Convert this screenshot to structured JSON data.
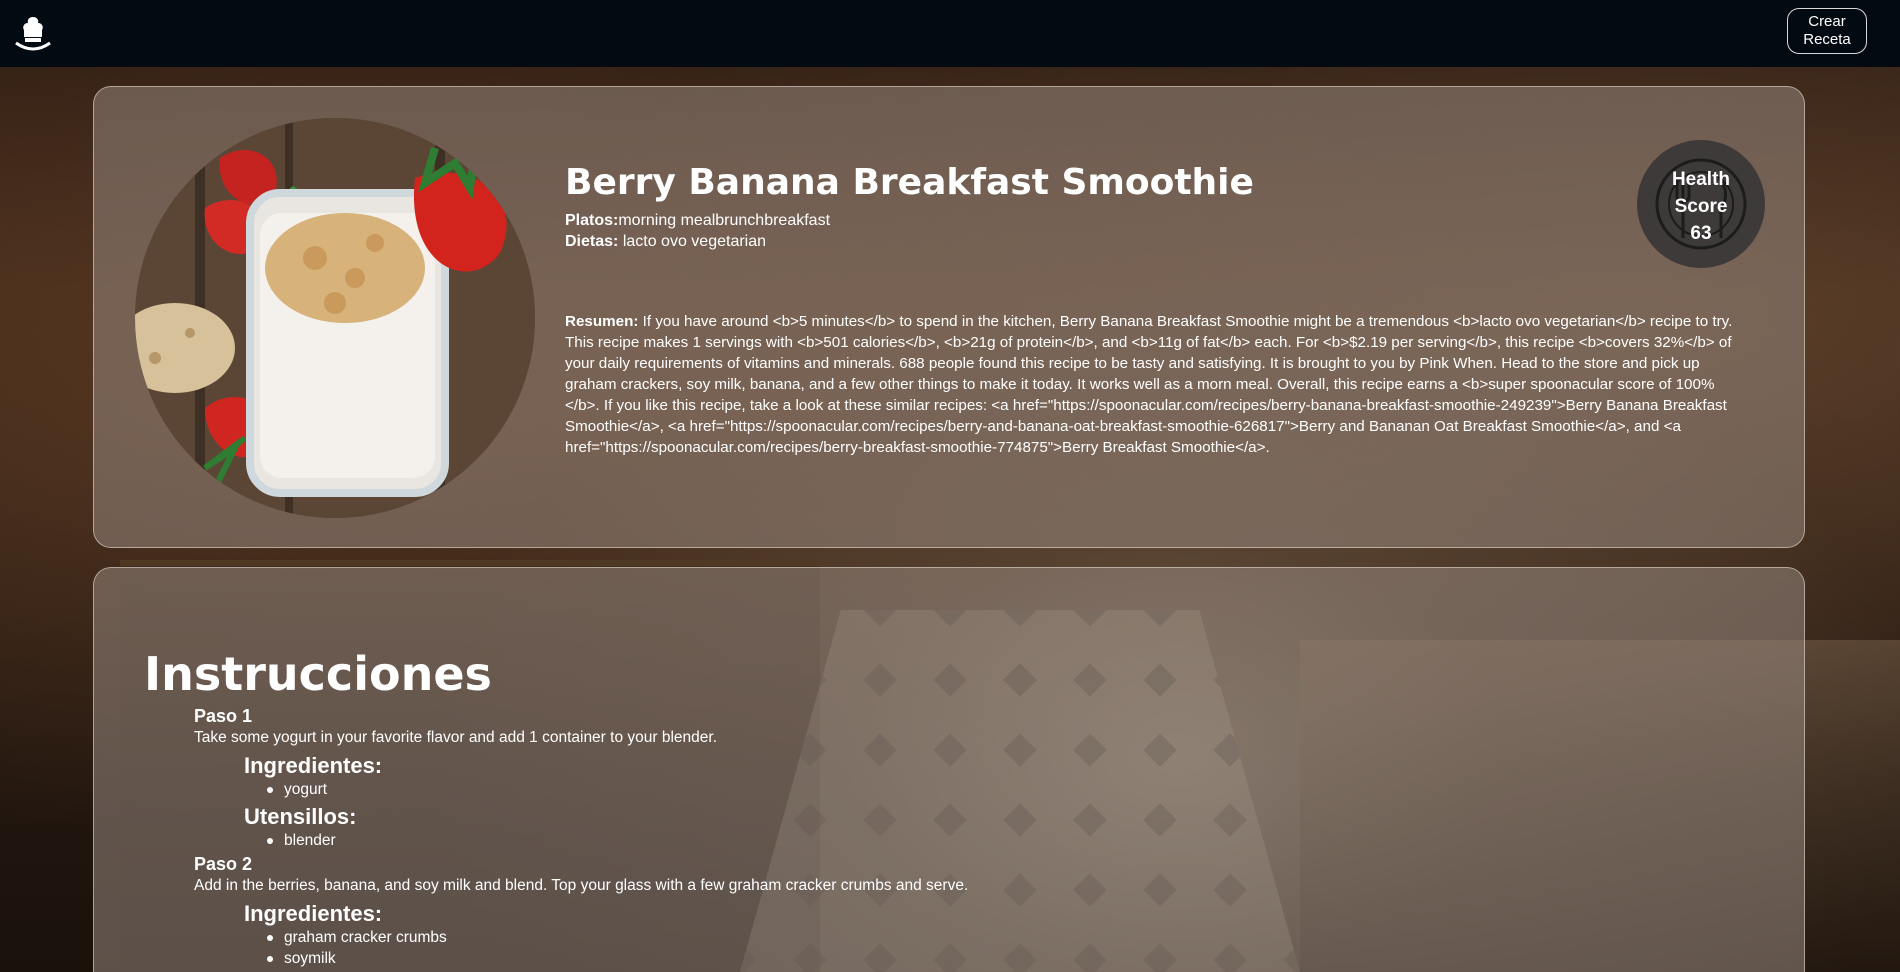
{
  "navbar": {
    "logo_icon": "chef-hat-icon",
    "create_button_label": "Crear Receta"
  },
  "recipe": {
    "title": "Berry Banana Breakfast Smoothie",
    "platos_label": "Platos:",
    "platos_value": "morning mealbrunchbreakfast",
    "dietas_label": "Dietas:",
    "dietas_value": "lacto ovo vegetarian",
    "summary_label": "Resumen:",
    "summary_text": "If you have around <b>5 minutes</b> to spend in the kitchen, Berry Banana Breakfast Smoothie might be a tremendous <b>lacto ovo vegetarian</b> recipe to try. This recipe makes 1 servings with <b>501 calories</b>, <b>21g of protein</b>, and <b>11g of fat</b> each. For <b>$2.19 per serving</b>, this recipe <b>covers 32%</b> of your daily requirements of vitamins and minerals. 688 people found this recipe to be tasty and satisfying. It is brought to you by Pink When. Head to the store and pick up graham crackers, soy milk, banana, and a few other things to make it today. It works well as a morn meal. Overall, this recipe earns a <b>super spoonacular score of 100%</b>. If you like this recipe, take a look at these similar recipes: <a href=\"https://spoonacular.com/recipes/berry-banana-breakfast-smoothie-249239\">Berry Banana Breakfast Smoothie</a>, <a href=\"https://spoonacular.com/recipes/berry-and-banana-oat-breakfast-smoothie-626817\">Berry and Bananan Oat Breakfast Smoothie</a>, and <a href=\"https://spoonacular.com/recipes/berry-breakfast-smoothie-774875\">Berry Breakfast Smoothie</a>.",
    "health": {
      "line1": "Health",
      "line2": "Score",
      "value": "63",
      "icon": "plate-fork-knife-icon"
    }
  },
  "instructions": {
    "title": "Instrucciones",
    "steps": [
      {
        "heading": "Paso 1",
        "text": "Take some yogurt in your favorite flavor and add 1 container to your blender.",
        "ingredients_label": "Ingredientes:",
        "ingredients": [
          "yogurt"
        ],
        "equipment_label": "Utensillos:",
        "equipment": [
          "blender"
        ]
      },
      {
        "heading": "Paso 2",
        "text": "Add in the berries, banana, and soy milk and blend. Top your glass with a few graham cracker crumbs and serve.",
        "ingredients_label": "Ingredientes:",
        "ingredients": [
          "graham cracker crumbs",
          "soymilk"
        ]
      }
    ]
  }
}
